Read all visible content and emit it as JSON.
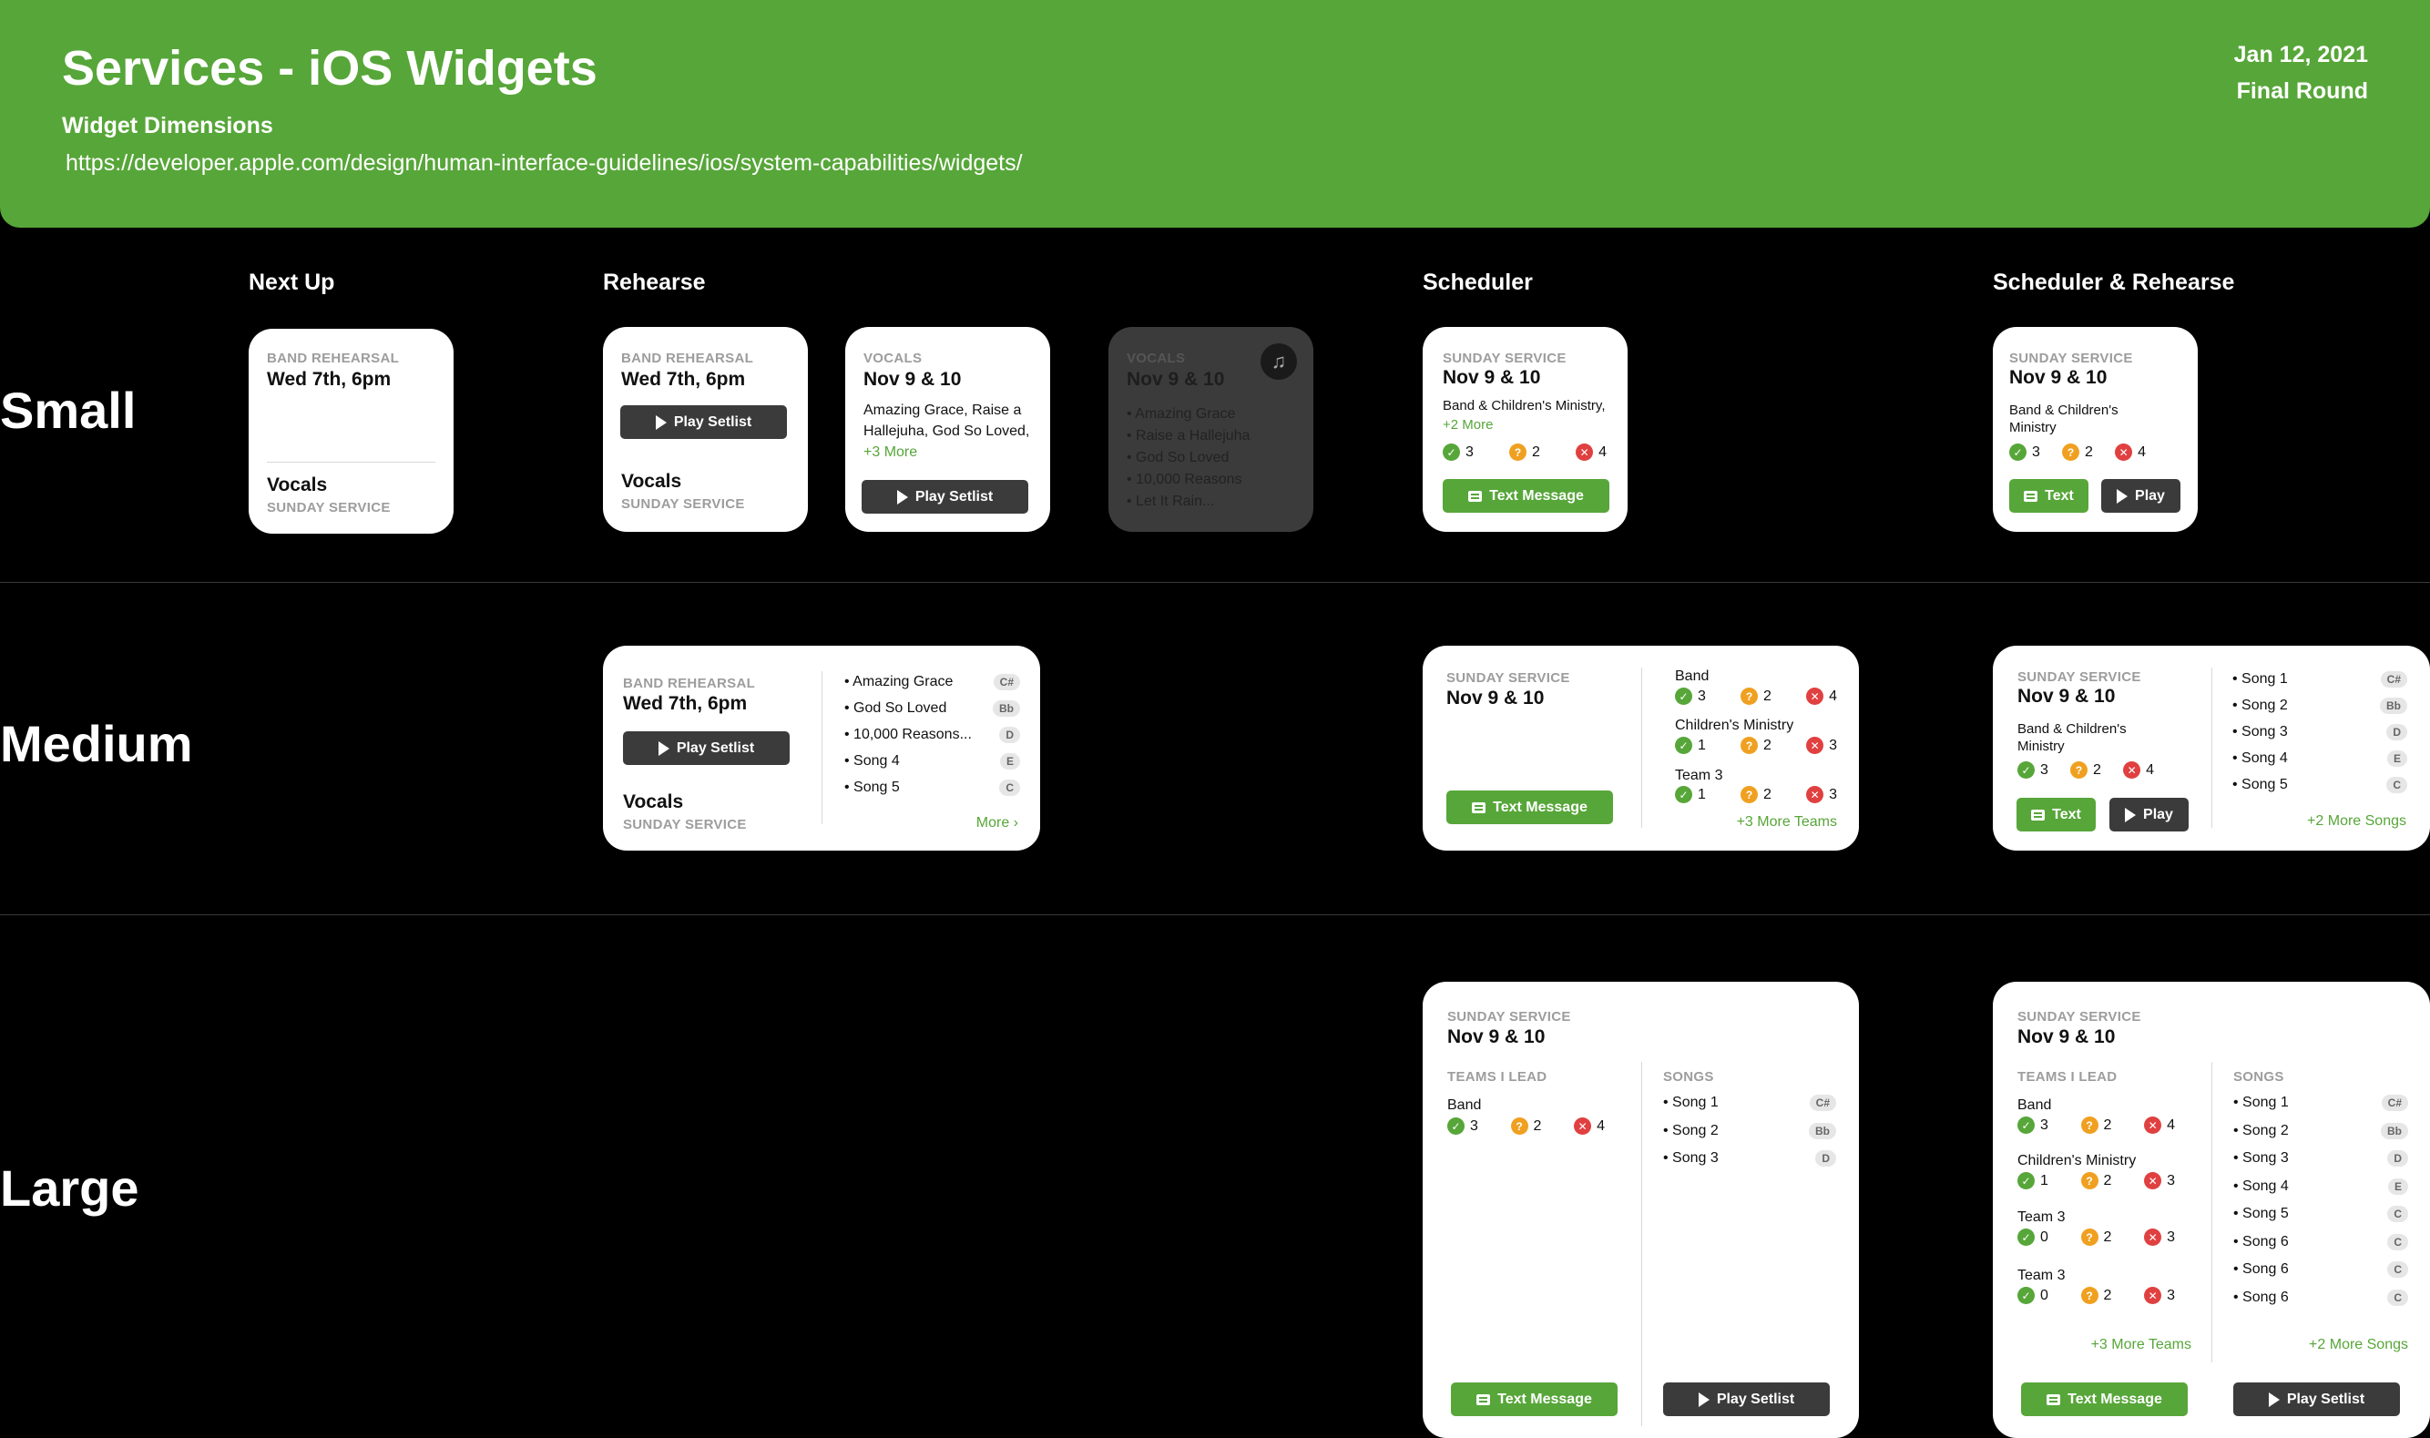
{
  "header": {
    "title": "Services - iOS Widgets",
    "subtitle": "Widget Dimensions",
    "url": "https://developer.apple.com/design/human-interface-guidelines/ios/system-capabilities/widgets/",
    "date": "Jan 12, 2021",
    "round": "Final Round"
  },
  "columns": [
    "Next Up",
    "Rehearse",
    "Scheduler",
    "Scheduler & Rehearse"
  ],
  "rows": [
    "Small",
    "Medium",
    "Large"
  ],
  "common": {
    "band_rehearsal": "BAND REHEARSAL",
    "sunday_service": "SUNDAY SERVICE",
    "vocals_lbl": "VOCALS",
    "wed": "Wed 7th, 6pm",
    "nov": "Nov 9 & 10",
    "vocals": "Vocals",
    "play_setlist": "Play Setlist",
    "text_message": "Text Message",
    "text": "Text",
    "play": "Play",
    "teams_i_lead": "TEAMS I LEAD",
    "songs": "SONGS",
    "more": "More",
    "more_teams": "+3 More Teams",
    "more_songs": "+2 More Songs",
    "plus3more": "+3 More"
  },
  "small": {
    "vocals_songs": "Amazing Grace, Raise a Hallejuha, God So Loved,",
    "dark_songs": [
      "• Amazing Grace",
      "• Raise a Hallejuha",
      "• God So Loved",
      "• 10,000 Reasons",
      "• Let It Rain..."
    ],
    "sched_teams": "Band & Children's Ministry,",
    "sched_more": "+2 More",
    "sr_teams": "Band & Children's Ministry",
    "counts": {
      "yes": "3",
      "maybe": "2",
      "no": "4"
    }
  },
  "medium": {
    "rehearse_songs": [
      {
        "name": "• Amazing Grace",
        "key": "C#"
      },
      {
        "name": "• God So Loved",
        "key": "Bb"
      },
      {
        "name": "• 10,000 Reasons...",
        "key": "D"
      },
      {
        "name": "• Song 4",
        "key": "E"
      },
      {
        "name": "• Song 5",
        "key": "C"
      }
    ],
    "sched_teams": [
      {
        "name": "Band",
        "yes": "3",
        "maybe": "2",
        "no": "4"
      },
      {
        "name": "Children's Ministry",
        "yes": "1",
        "maybe": "2",
        "no": "3"
      },
      {
        "name": "Team 3",
        "yes": "1",
        "maybe": "2",
        "no": "3"
      }
    ],
    "sr_teams": "Band & Children's Ministry",
    "sr_counts": {
      "yes": "3",
      "maybe": "2",
      "no": "4"
    },
    "sr_songs": [
      {
        "name": "• Song 1",
        "key": "C#"
      },
      {
        "name": "• Song 2",
        "key": "Bb"
      },
      {
        "name": "• Song 3",
        "key": "D"
      },
      {
        "name": "• Song 4",
        "key": "E"
      },
      {
        "name": "• Song 5",
        "key": "C"
      }
    ]
  },
  "large": {
    "sched_team": {
      "name": "Band",
      "yes": "3",
      "maybe": "2",
      "no": "4"
    },
    "sched_songs": [
      {
        "name": "• Song 1",
        "key": "C#"
      },
      {
        "name": "• Song 2",
        "key": "Bb"
      },
      {
        "name": "• Song 3",
        "key": "D"
      }
    ],
    "sr_teams": [
      {
        "name": "Band",
        "yes": "3",
        "maybe": "2",
        "no": "4"
      },
      {
        "name": "Children's Ministry",
        "yes": "1",
        "maybe": "2",
        "no": "3"
      },
      {
        "name": "Team 3",
        "yes": "0",
        "maybe": "2",
        "no": "3"
      },
      {
        "name": "Team 3",
        "yes": "0",
        "maybe": "2",
        "no": "3"
      }
    ],
    "sr_songs": [
      {
        "name": "• Song 1",
        "key": "C#"
      },
      {
        "name": "• Song 2",
        "key": "Bb"
      },
      {
        "name": "• Song 3",
        "key": "D"
      },
      {
        "name": "• Song 4",
        "key": "E"
      },
      {
        "name": "• Song 5",
        "key": "C"
      },
      {
        "name": "• Song 6",
        "key": "C"
      },
      {
        "name": "• Song 6",
        "key": "C"
      },
      {
        "name": "• Song 6",
        "key": "C"
      }
    ]
  },
  "colors": {
    "brand": "#57a639",
    "dark_button": "#3b3b3b",
    "yes": "#57a639",
    "maybe": "#f0a020",
    "no": "#e04040"
  },
  "icons": {
    "play": "play-icon",
    "message": "message-icon",
    "music": "music-note-icon",
    "check": "check-icon",
    "question": "question-icon",
    "x": "x-icon",
    "chevron": "chevron-right-icon"
  }
}
